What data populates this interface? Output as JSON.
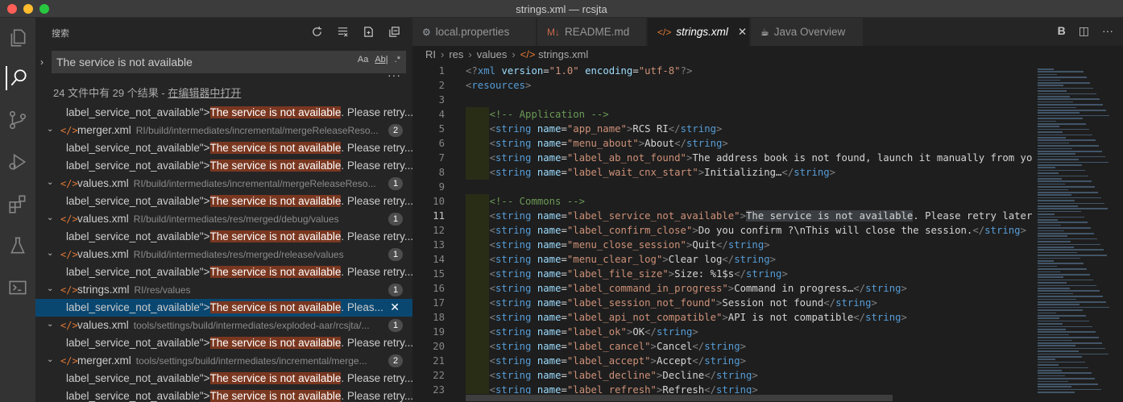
{
  "window": {
    "title": "strings.xml — rcsjta"
  },
  "activity_bar": {
    "icons": [
      "files-icon",
      "search-icon",
      "source-control-icon",
      "run-debug-icon",
      "extensions-icon",
      "flask-icon",
      "terminal-icon"
    ]
  },
  "sidebar": {
    "title": "搜索",
    "search_value": "The service is not available",
    "opt_case": "Aa",
    "opt_word": "Ab|",
    "opt_regex": ".*",
    "summary_text": "24 文件中有 29 个结果 - ",
    "summary_link": "在编辑器中打开",
    "results": [
      {
        "kind": "match",
        "prefix": "label_service_not_available\">",
        "hit": "The service is not available",
        "suffix": ". Please retry..."
      },
      {
        "kind": "file",
        "name": "merger.xml",
        "path": "RI/build/intermediates/incremental/mergeReleaseReso...",
        "count": "2"
      },
      {
        "kind": "match",
        "prefix": "label_service_not_available\">",
        "hit": "The service is not available",
        "suffix": ". Please retry..."
      },
      {
        "kind": "match",
        "prefix": "label_service_not_available\">",
        "hit": "The service is not available",
        "suffix": ". Please retry..."
      },
      {
        "kind": "file",
        "name": "values.xml",
        "path": "RI/build/intermediates/incremental/mergeReleaseReso...",
        "count": "1"
      },
      {
        "kind": "match",
        "prefix": "label_service_not_available\">",
        "hit": "The service is not available",
        "suffix": ". Please retry..."
      },
      {
        "kind": "file",
        "name": "values.xml",
        "path": "RI/build/intermediates/res/merged/debug/values",
        "count": "1"
      },
      {
        "kind": "match",
        "prefix": "label_service_not_available\">",
        "hit": "The service is not available",
        "suffix": ". Please retry..."
      },
      {
        "kind": "file",
        "name": "values.xml",
        "path": "RI/build/intermediates/res/merged/release/values",
        "count": "1"
      },
      {
        "kind": "match",
        "prefix": "label_service_not_available\">",
        "hit": "The service is not available",
        "suffix": ". Please retry..."
      },
      {
        "kind": "file",
        "name": "strings.xml",
        "path": "RI/res/values",
        "count": "1"
      },
      {
        "kind": "match",
        "selected": true,
        "prefix": "label_service_not_available\">",
        "hit": "The service is not available",
        "suffix": ". Pleas..."
      },
      {
        "kind": "file",
        "name": "values.xml",
        "path": "tools/settings/build/intermediates/exploded-aar/rcsjta/...",
        "count": "1"
      },
      {
        "kind": "match",
        "prefix": "label_service_not_available\">",
        "hit": "The service is not available",
        "suffix": ". Please retry..."
      },
      {
        "kind": "file",
        "name": "merger.xml",
        "path": "tools/settings/build/intermediates/incremental/merge...",
        "count": "2"
      },
      {
        "kind": "match",
        "prefix": "label_service_not_available\">",
        "hit": "The service is not available",
        "suffix": ". Please retry..."
      },
      {
        "kind": "match",
        "prefix": "label_service_not_available\">",
        "hit": "The service is not available",
        "suffix": ". Please retry..."
      }
    ]
  },
  "tabs": [
    {
      "label": "local.properties",
      "icon": "gear-icon",
      "glyph": "⚙",
      "color": "#9aa0a6"
    },
    {
      "label": "README.md",
      "icon": "markdown-icon",
      "glyph": "M↓",
      "color": "#c9694c"
    },
    {
      "label": "strings.xml",
      "icon": "xml-icon",
      "glyph": "</>",
      "color": "#e37933",
      "active": true
    },
    {
      "label": "Java Overview",
      "icon": "java-icon",
      "glyph": "☕",
      "color": "#f0f0f0"
    }
  ],
  "tab_actions": {
    "bold": "B",
    "split": "◫",
    "more": "···"
  },
  "breadcrumbs": [
    "RI",
    "res",
    "values",
    "strings.xml"
  ],
  "code_lines": [
    {
      "n": "1",
      "t": "<?xml version=\"1.0\" encoding=\"utf-8\"?>"
    },
    {
      "n": "2",
      "t": "<resources>"
    },
    {
      "n": "3",
      "t": ""
    },
    {
      "n": "4",
      "t": "    <!-- Application -->"
    },
    {
      "n": "5",
      "t": "    <string name=\"app_name\">RCS RI</string>"
    },
    {
      "n": "6",
      "t": "    <string name=\"menu_about\">About</string>"
    },
    {
      "n": "7",
      "t": "    <string name=\"label_ab_not_found\">The address book is not found, launch it manually from your"
    },
    {
      "n": "8",
      "t": "    <string name=\"label_wait_cnx_start\">Initializing…</string>"
    },
    {
      "n": "9",
      "t": ""
    },
    {
      "n": "10",
      "t": "    <!-- Commons -->"
    },
    {
      "n": "11",
      "t": "    <string name=\"label_service_not_available\">The service is not available. Please retry later.<"
    },
    {
      "n": "12",
      "t": "    <string name=\"label_confirm_close\">Do you confirm ?\\nThis will close the session.</string>"
    },
    {
      "n": "13",
      "t": "    <string name=\"menu_close_session\">Quit</string>"
    },
    {
      "n": "14",
      "t": "    <string name=\"menu_clear_log\">Clear log</string>"
    },
    {
      "n": "15",
      "t": "    <string name=\"label_file_size\">Size: %1$s</string>"
    },
    {
      "n": "16",
      "t": "    <string name=\"label_command_in_progress\">Command in progress…</string>"
    },
    {
      "n": "17",
      "t": "    <string name=\"label_session_not_found\">Session not found</string>"
    },
    {
      "n": "18",
      "t": "    <string name=\"label_api_not_compatible\">API is not compatible</string>"
    },
    {
      "n": "19",
      "t": "    <string name=\"label_ok\">OK</string>"
    },
    {
      "n": "20",
      "t": "    <string name=\"label_cancel\">Cancel</string>"
    },
    {
      "n": "21",
      "t": "    <string name=\"label_accept\">Accept</string>"
    },
    {
      "n": "22",
      "t": "    <string name=\"label_decline\">Decline</string>"
    },
    {
      "n": "23",
      "t": "    <string name=\"label_refresh\">Refresh</string>"
    }
  ],
  "highlight": "The service is not available"
}
